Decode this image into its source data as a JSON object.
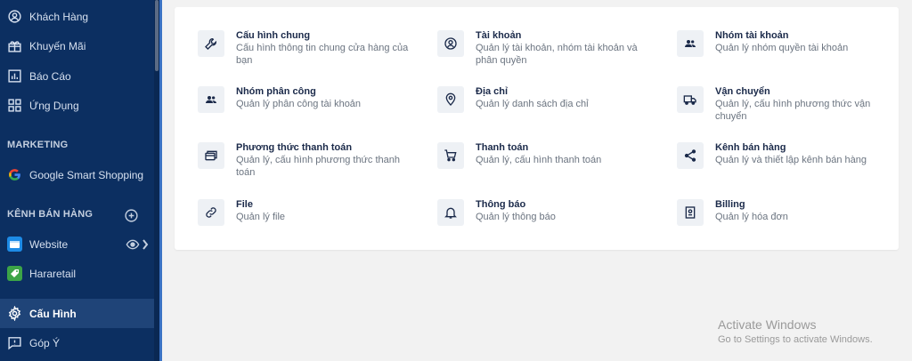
{
  "sidebar": {
    "items": [
      {
        "label": "Khách Hàng",
        "icon": "user-circle-icon"
      },
      {
        "label": "Khuyến Mãi",
        "icon": "gift-icon"
      },
      {
        "label": "Báo Cáo",
        "icon": "chart-icon"
      },
      {
        "label": "Ứng Dụng",
        "icon": "apps-icon"
      }
    ],
    "marketing_title": "MARKETING",
    "marketing_items": [
      {
        "label": "Google Smart Shopping",
        "icon": "google-icon"
      }
    ],
    "channels_title": "KÊNH BÁN HÀNG",
    "channels": [
      {
        "label": "Website",
        "icon": "website-icon",
        "color": "#1d8be6"
      },
      {
        "label": "Hararetail",
        "icon": "tag-icon",
        "color": "#3ca447"
      }
    ],
    "bottom_items": [
      {
        "label": "Cấu Hình",
        "icon": "gear-icon",
        "active": true
      },
      {
        "label": "Góp Ý",
        "icon": "feedback-icon"
      }
    ]
  },
  "settings": [
    {
      "title": "Cấu hình chung",
      "desc": "Cấu hình thông tin chung cửa hàng của bạn",
      "icon": "wrench-icon"
    },
    {
      "title": "Tài khoản",
      "desc": "Quản lý tài khoản, nhóm tài khoản và phân quyền",
      "icon": "account-icon"
    },
    {
      "title": "Nhóm tài khoản",
      "desc": "Quản lý nhóm quyền tài khoản",
      "icon": "group-icon"
    },
    {
      "title": "Nhóm phân công",
      "desc": "Quản lý phân công tài khoản",
      "icon": "group-icon"
    },
    {
      "title": "Địa chỉ",
      "desc": "Quản lý danh sách địa chỉ",
      "icon": "location-icon"
    },
    {
      "title": "Vận chuyển",
      "desc": "Quản lý, cấu hình phương thức vận chuyển",
      "icon": "truck-icon"
    },
    {
      "title": "Phương thức thanh toán",
      "desc": "Quản lý, cấu hình phương thức thanh toán",
      "icon": "payment-icon"
    },
    {
      "title": "Thanh toán",
      "desc": "Quản lý, cấu hình thanh toán",
      "icon": "cart-icon"
    },
    {
      "title": "Kênh bán hàng",
      "desc": "Quản lý và thiết lập kênh bán hàng",
      "icon": "share-icon"
    },
    {
      "title": "File",
      "desc": "Quản lý file",
      "icon": "link-icon"
    },
    {
      "title": "Thông báo",
      "desc": "Quản lý thông báo",
      "icon": "bell-icon"
    },
    {
      "title": "Billing",
      "desc": "Quản lý hóa đơn",
      "icon": "billing-icon"
    }
  ],
  "watermark": {
    "line1": "Activate Windows",
    "line2": "Go to Settings to activate Windows."
  },
  "colors": {
    "sidebar_bg": "#0c2f61",
    "active_bg": "#1f4478",
    "accent": "#3b73c4",
    "title_text": "#1b2a4a"
  }
}
